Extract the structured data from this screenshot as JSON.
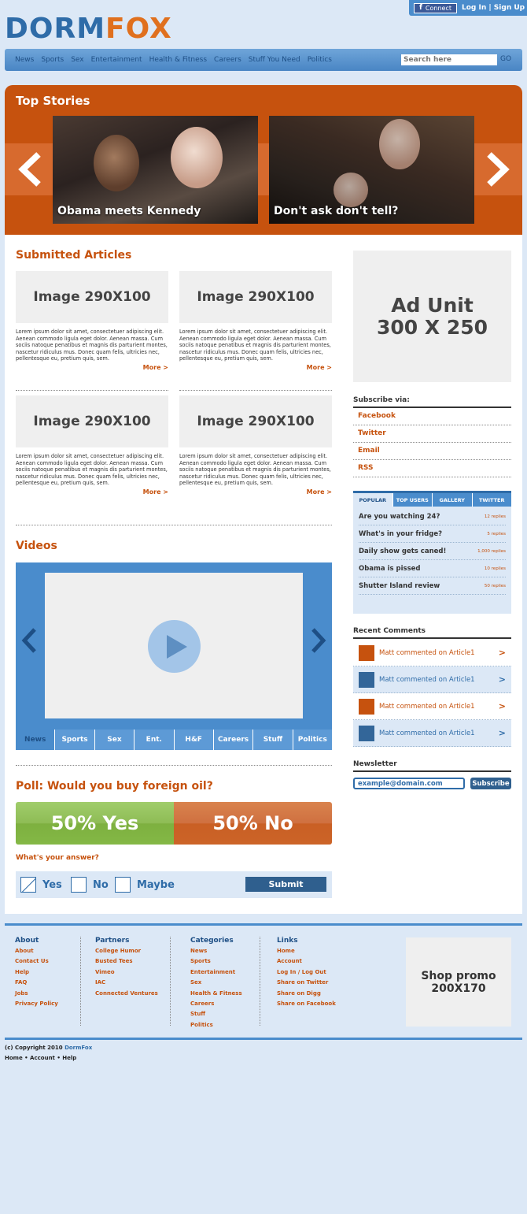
{
  "header": {
    "fb_connect": "Connect",
    "auth_links": "Log In | Sign Up",
    "logo_part1": "DORM",
    "logo_part2": "FOX"
  },
  "nav": {
    "items": [
      "News",
      "Sports",
      "Sex",
      "Entertainment",
      "Health & Fitness",
      "Careers",
      "Stuff You Need",
      "Politics"
    ],
    "search_placeholder": "Search here",
    "search_go": "GO"
  },
  "top_stories": {
    "title": "Top Stories",
    "prev": "<",
    "next": ">",
    "stories": [
      {
        "caption": "Obama meets Kennedy"
      },
      {
        "caption": "Don't ask don't tell?"
      }
    ]
  },
  "submitted": {
    "title": "Submitted Articles",
    "articles": [
      {
        "image": "Image 290X100",
        "text": "Lorem ipsum dolor sit amet, consectetuer adipiscing elit. Aenean commodo ligula eget dolor. Aenean massa. Cum sociis natoque penatibus et magnis dis parturient montes, nascetur ridiculus mus. Donec quam felis, ultricies nec, pellentesque eu, pretium quis, sem.",
        "more": "More >"
      },
      {
        "image": "Image 290X100",
        "text": "Lorem ipsum dolor sit amet, consectetuer adipiscing elit. Aenean commodo ligula eget dolor. Aenean massa. Cum sociis natoque penatibus et magnis dis parturient montes, nascetur ridiculus mus. Donec quam felis, ultricies nec, pellentesque eu, pretium quis, sem.",
        "more": "More >"
      },
      {
        "image": "Image 290X100",
        "text": "Lorem ipsum dolor sit amet, consectetuer adipiscing elit. Aenean commodo ligula eget dolor. Aenean massa. Cum sociis natoque penatibus et magnis dis parturient montes, nascetur ridiculus mus. Donec quam felis, ultricies nec, pellentesque eu, pretium quis, sem.",
        "more": "More >"
      },
      {
        "image": "Image 290X100",
        "text": "Lorem ipsum dolor sit amet, consectetuer adipiscing elit. Aenean commodo ligula eget dolor. Aenean massa. Cum sociis natoque penatibus et magnis dis parturient montes, nascetur ridiculus mus. Donec quam felis, ultricies nec, pellentesque eu, pretium quis, sem.",
        "more": "More >"
      }
    ]
  },
  "videos": {
    "title": "Videos",
    "tabs": [
      "News",
      "Sports",
      "Sex",
      "Ent.",
      "H&F",
      "Careers",
      "Stuff",
      "Politics"
    ],
    "active_tab": "News"
  },
  "poll": {
    "title": "Poll: Would you buy foreign oil?",
    "yes_result": "50% Yes",
    "no_result": "50% No",
    "yes_percent": 50,
    "no_percent": 50,
    "question": "What's your answer?",
    "options": [
      "Yes",
      "No",
      "Maybe"
    ],
    "selected": "Yes",
    "submit": "Submit"
  },
  "sidebar": {
    "ad_line1": "Ad Unit",
    "ad_line2": "300 X 250",
    "subscribe_title": "Subscribe via:",
    "subscribe_items": [
      "Facebook",
      "Twitter",
      "Email",
      "RSS"
    ],
    "tabs": [
      "POPULAR",
      "TOP USERS",
      "GALLERY",
      "TWITTER"
    ],
    "popular": [
      {
        "title": "Are you watching 24?",
        "replies": "12 replies"
      },
      {
        "title": "What's in your fridge?",
        "replies": "5 replies"
      },
      {
        "title": "Daily show gets caned!",
        "replies": "1,000 replies"
      },
      {
        "title": "Obama is pissed",
        "replies": "10 replies"
      },
      {
        "title": "Shutter Island review",
        "replies": "50 replies"
      }
    ],
    "recent_title": "Recent Comments",
    "comments": [
      {
        "text": "Matt commented on Article1",
        "chevron": ">"
      },
      {
        "text": "Matt commented on Article1",
        "chevron": ">"
      },
      {
        "text": "Matt commented on Article1",
        "chevron": ">"
      },
      {
        "text": "Matt commented on Article1",
        "chevron": ">"
      }
    ],
    "newsletter_title": "Newsletter",
    "newsletter_placeholder": "example@domain.com",
    "newsletter_button": "Subscribe"
  },
  "footer": {
    "about": {
      "title": "About",
      "links": [
        "About",
        "Contact Us",
        "Help",
        "FAQ",
        "Jobs",
        "Privacy Policy"
      ]
    },
    "partners": {
      "title": "Partners",
      "links": [
        "College Humor",
        "Busted Tees",
        "Vimeo",
        "IAC",
        "Connected Ventures"
      ]
    },
    "categories": {
      "title": "Categories",
      "links": [
        "News",
        "Sports",
        "Entertainment",
        "Sex",
        "Health & Fitness",
        "Careers",
        "Stuff",
        "Politics"
      ]
    },
    "links": {
      "title": "Links",
      "links": [
        "Home",
        "Account",
        "Log In / Log Out",
        "Share on Twitter",
        "Share on Digg",
        "Share on Facebook"
      ]
    },
    "promo_line1": "Shop promo",
    "promo_line2": "200X170",
    "copyright": "(c) Copyright 2010 ",
    "copyright_brand": "DormFox",
    "bottom_links": "Home • Account • Help"
  },
  "colors": {
    "brand_blue": "#2f6ca8",
    "brand_orange": "#c6520e",
    "page_bg": "#dce8f6",
    "poll_yes": "#8ebc55",
    "poll_no": "#cc6428",
    "avatar_orange": "#c6520e",
    "avatar_blue": "#336699"
  }
}
